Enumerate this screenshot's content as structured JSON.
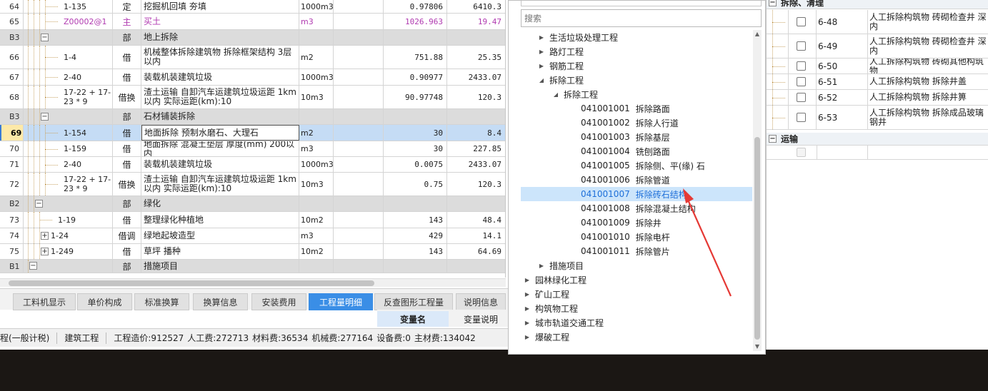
{
  "grid": {
    "rows": [
      {
        "no": "64",
        "code": "1-135",
        "type": "定",
        "name": "挖掘机回填 夯填",
        "unit": "1000m3",
        "qty": "0.97806",
        "price": "6410.3",
        "kind": "item",
        "level": 4
      },
      {
        "no": "65",
        "code": "Z00002@1",
        "type": "主",
        "name": "买土",
        "unit": "m3",
        "qty": "1026.963",
        "price": "19.47",
        "kind": "main",
        "level": 4
      },
      {
        "no": "B3",
        "code": "",
        "type": "部",
        "name": "地上拆除",
        "unit": "",
        "qty": "",
        "price": "",
        "kind": "group",
        "level": 3,
        "box": "−"
      },
      {
        "no": "66",
        "code": "1-4",
        "type": "借",
        "name": "机械整体拆除建筑物 拆除框架结构 3层以内",
        "unit": "m2",
        "qty": "751.88",
        "price": "25.35",
        "kind": "item",
        "level": 4
      },
      {
        "no": "67",
        "code": "2-40",
        "type": "借",
        "name": "装载机装建筑垃圾",
        "unit": "1000m3",
        "qty": "0.90977",
        "price": "2433.07",
        "kind": "item",
        "level": 4
      },
      {
        "no": "68",
        "code": "17-22 + 17-23 * 9",
        "type": "借换",
        "name": "渣土运输 自卸汽车运建筑垃圾运距 1km以内  实际运距(km):10",
        "unit": "10m3",
        "qty": "90.97748",
        "price": "120.3",
        "kind": "item",
        "level": 4
      },
      {
        "no": "B3",
        "code": "",
        "type": "部",
        "name": "石材铺装拆除",
        "unit": "",
        "qty": "",
        "price": "",
        "kind": "group",
        "level": 3,
        "box": "−"
      },
      {
        "no": "69",
        "code": "1-154",
        "type": "借",
        "name": "地面拆除 预制水磨石、大理石",
        "unit": "m2",
        "qty": "30",
        "price": "8.4",
        "kind": "sel",
        "level": 4
      },
      {
        "no": "70",
        "code": "1-159",
        "type": "借",
        "name": "地面拆除 混凝土垫层 厚度(mm) 200以内",
        "unit": "m3",
        "qty": "30",
        "price": "227.85",
        "kind": "item",
        "level": 4
      },
      {
        "no": "71",
        "code": "2-40",
        "type": "借",
        "name": "装载机装建筑垃圾",
        "unit": "1000m3",
        "qty": "0.0075",
        "price": "2433.07",
        "kind": "item",
        "level": 4
      },
      {
        "no": "72",
        "code": "17-22 + 17-23 * 9",
        "type": "借换",
        "name": "渣土运输 自卸汽车运建筑垃圾运距 1km以内  实际运距(km):10",
        "unit": "10m3",
        "qty": "0.75",
        "price": "120.3",
        "kind": "item",
        "level": 4
      },
      {
        "no": "B2",
        "code": "",
        "type": "部",
        "name": "绿化",
        "unit": "",
        "qty": "",
        "price": "",
        "kind": "group",
        "level": 2,
        "box": "−"
      },
      {
        "no": "73",
        "code": "1-19",
        "type": "借",
        "name": "整理绿化种植地",
        "unit": "10m2",
        "qty": "143",
        "price": "48.4",
        "kind": "item",
        "level": 3
      },
      {
        "no": "74",
        "code": "1-24",
        "type": "借调",
        "name": "绿地起坡造型",
        "unit": "m3",
        "qty": "429",
        "price": "14.1",
        "kind": "item",
        "level": 3,
        "box": "+"
      },
      {
        "no": "75",
        "code": "1-249",
        "type": "借",
        "name": "草坪 播种",
        "unit": "10m2",
        "qty": "143",
        "price": "64.69",
        "kind": "item",
        "level": 3,
        "box": "+"
      },
      {
        "no": "B1",
        "code": "",
        "type": "部",
        "name": "措施项目",
        "unit": "",
        "qty": "",
        "price": "",
        "kind": "group",
        "level": 1,
        "box": "−"
      }
    ]
  },
  "tabs": [
    "工料机显示",
    "单价构成",
    "标准换算",
    "换算信息",
    "安装费用",
    "工程量明细",
    "反查图形工程量",
    "说明信息"
  ],
  "active_tab": "工程量明细",
  "var_header": {
    "name": "变量名",
    "desc": "变量说明"
  },
  "status": {
    "tax_mode": "程(一般计税)",
    "project_type": "建筑工程",
    "costs": [
      "工程造价:912527",
      "人工费:272713",
      "材料费:36534",
      "机械费:277164",
      "设备费:0",
      "主材费:134042"
    ]
  },
  "tree": {
    "search_placeholder": "搜索",
    "nodes": [
      {
        "label": "生活垃圾处理工程",
        "code": "",
        "indent": 2,
        "arrow": "right"
      },
      {
        "label": "路灯工程",
        "code": "",
        "indent": 2,
        "arrow": "right"
      },
      {
        "label": "钢筋工程",
        "code": "",
        "indent": 2,
        "arrow": "right"
      },
      {
        "label": "拆除工程",
        "code": "",
        "indent": 2,
        "arrow": "down"
      },
      {
        "label": "拆除工程",
        "code": "",
        "indent": 3,
        "arrow": "down"
      },
      {
        "label": "拆除路面",
        "code": "041001001",
        "indent": 4,
        "arrow": ""
      },
      {
        "label": "拆除人行道",
        "code": "041001002",
        "indent": 4,
        "arrow": ""
      },
      {
        "label": "拆除基层",
        "code": "041001003",
        "indent": 4,
        "arrow": ""
      },
      {
        "label": "铣刨路面",
        "code": "041001004",
        "indent": 4,
        "arrow": ""
      },
      {
        "label": "拆除侧、平(缘) 石",
        "code": "041001005",
        "indent": 4,
        "arrow": ""
      },
      {
        "label": "拆除管道",
        "code": "041001006",
        "indent": 4,
        "arrow": ""
      },
      {
        "label": "拆除砖石结构",
        "code": "041001007",
        "indent": 4,
        "arrow": "",
        "highlight": true
      },
      {
        "label": "拆除混凝土结构",
        "code": "041001008",
        "indent": 4,
        "arrow": ""
      },
      {
        "label": "拆除井",
        "code": "041001009",
        "indent": 4,
        "arrow": ""
      },
      {
        "label": "拆除电杆",
        "code": "041001010",
        "indent": 4,
        "arrow": ""
      },
      {
        "label": "拆除管片",
        "code": "041001011",
        "indent": 4,
        "arrow": ""
      },
      {
        "label": "措施项目",
        "code": "",
        "indent": 2,
        "arrow": "right"
      },
      {
        "label": "园林绿化工程",
        "code": "",
        "indent": 1,
        "arrow": "right"
      },
      {
        "label": "矿山工程",
        "code": "",
        "indent": 1,
        "arrow": "right"
      },
      {
        "label": "构筑物工程",
        "code": "",
        "indent": 1,
        "arrow": "right"
      },
      {
        "label": "城市轨道交通工程",
        "code": "",
        "indent": 1,
        "arrow": "right"
      },
      {
        "label": "爆破工程",
        "code": "",
        "indent": 1,
        "arrow": "right"
      }
    ]
  },
  "right": {
    "group1": "拆除、清理",
    "items": [
      {
        "code": "6-48",
        "name": "人工拆除构筑物 砖砌检查井 深内"
      },
      {
        "code": "6-49",
        "name": "人工拆除构筑物 砖砌检查井 深内"
      },
      {
        "code": "6-50",
        "name": "人工拆除构筑物 砖砌其他构筑物"
      },
      {
        "code": "6-51",
        "name": "人工拆除构筑物 拆除井盖"
      },
      {
        "code": "6-52",
        "name": "人工拆除构筑物 拆除井箅"
      },
      {
        "code": "6-53",
        "name": "人工拆除构筑物 拆除成品玻璃钢井"
      }
    ],
    "group2": "运输"
  },
  "colors": {
    "accent": "#3a8ee6",
    "selected_row": "#c5dcf5",
    "highlight_node": "#cce5fb",
    "arrow": "#e53935"
  }
}
